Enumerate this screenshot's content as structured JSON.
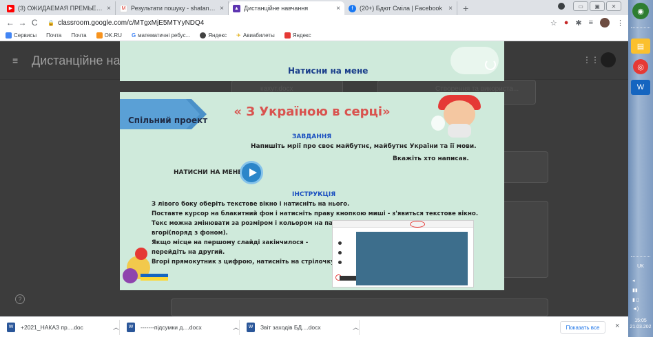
{
  "tabs": [
    {
      "title": "(3) ОЖИДАЕМАЯ ПРЕМЬЕРА 20",
      "color": "#ff0000",
      "glyph": "▶",
      "active": false
    },
    {
      "title": "Результати пошуку - shatan80@",
      "color": "#ffffff",
      "glyph": "M",
      "active": false
    },
    {
      "title": "Дистанційне навчання",
      "color": "#5e35b1",
      "glyph": "▲",
      "active": true
    },
    {
      "title": "(20+) Бдют Сміла | Facebook",
      "color": "#1877f2",
      "glyph": "f",
      "active": false
    }
  ],
  "tab_close": "×",
  "new_tab": "+",
  "address": {
    "url": "classroom.google.com/c/MTgxMjE5MTYyNDQ4"
  },
  "bookmarks": [
    {
      "label": "Сервисы",
      "color": "#4285f4"
    },
    {
      "label": "Почта",
      "color": ""
    },
    {
      "label": "Почта",
      "color": ""
    },
    {
      "label": "OK.RU",
      "color": "#f7931e"
    },
    {
      "label": "математичні ребус...",
      "color": "#4285f4"
    },
    {
      "label": "Яндекс",
      "color": "#424242"
    },
    {
      "label": "Авиабилеты",
      "color": "#ffcc00"
    },
    {
      "label": "Яндекс",
      "color": "#e53935"
    }
  ],
  "app": {
    "name": "Дистанційне навчання",
    "bg_texts": [
      "кахут.docx",
      "Створення та використа..."
    ]
  },
  "slide_top": {
    "button_label": "Натисни на мене"
  },
  "slide": {
    "ribbon_label": "Спільний проект",
    "title": "« З Україною в серці»",
    "task_heading": "ЗАВДАННЯ",
    "task_text": "Напишіть мрії про своє майбутнє, майбутнє України та її мови.",
    "task_text2": "Вкажіть хто написав.",
    "press_label": "НАТИСНИ НА МЕНЕ",
    "instruction_heading": "ІНСТРУКЦІЯ",
    "instructions": [
      "З лівого боку оберіть текстове вікно і натисніть на нього.",
      " Поставте курсор на блакитний фон і натисніть праву кнопкою миші - з'явиться текстове вікно.",
      "Текс можна змінювати за розміром і кольором на панелі",
      "вгорі(поряд з фоном).",
      "Якщо місце на першому слайді закінчилося -",
      "перейдіть на другий.",
      "Вгорі прямокутник з цифрою, натисніть на стрілочку."
    ]
  },
  "downloads": {
    "items": [
      {
        "name": "+2021_НАКАЗ пр....doc"
      },
      {
        "name": "-------підсумки д....docx"
      },
      {
        "name": "Звіт заходів БД....docx"
      }
    ],
    "show_all": "Показать все",
    "close": "×"
  },
  "taskbar": {
    "lang": "UK",
    "time": "15:05",
    "date": "21.03.202"
  }
}
